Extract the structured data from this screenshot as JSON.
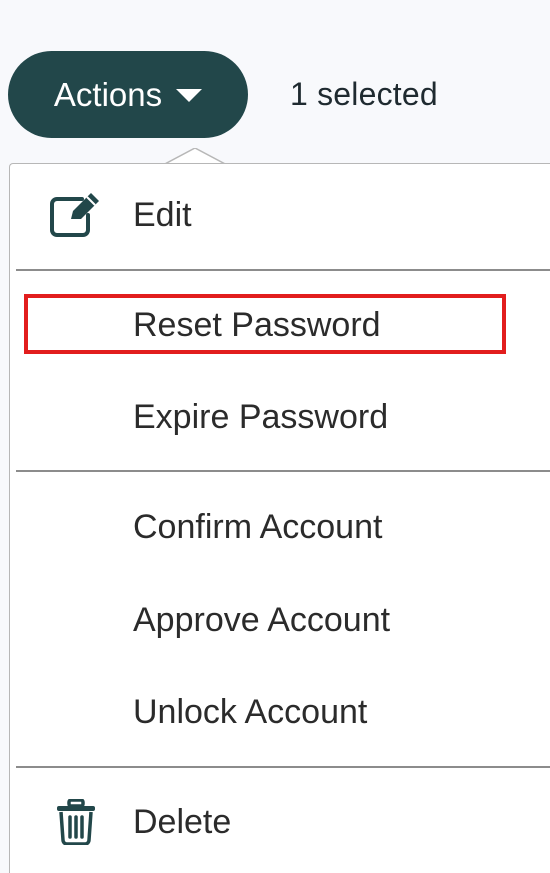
{
  "toolbar": {
    "actions_label": "Actions",
    "selected_text": "1 selected"
  },
  "menu": {
    "items": [
      {
        "label": "Edit",
        "icon": "edit-icon"
      },
      {
        "label": "Reset Password",
        "icon": ""
      },
      {
        "label": "Expire Password",
        "icon": ""
      },
      {
        "label": "Confirm Account",
        "icon": ""
      },
      {
        "label": "Approve Account",
        "icon": ""
      },
      {
        "label": "Unlock Account",
        "icon": ""
      },
      {
        "label": "Delete",
        "icon": "trash-icon"
      }
    ]
  },
  "colors": {
    "button_bg": "#22474a",
    "icon_color": "#22474a",
    "highlight": "#e21d1d"
  }
}
